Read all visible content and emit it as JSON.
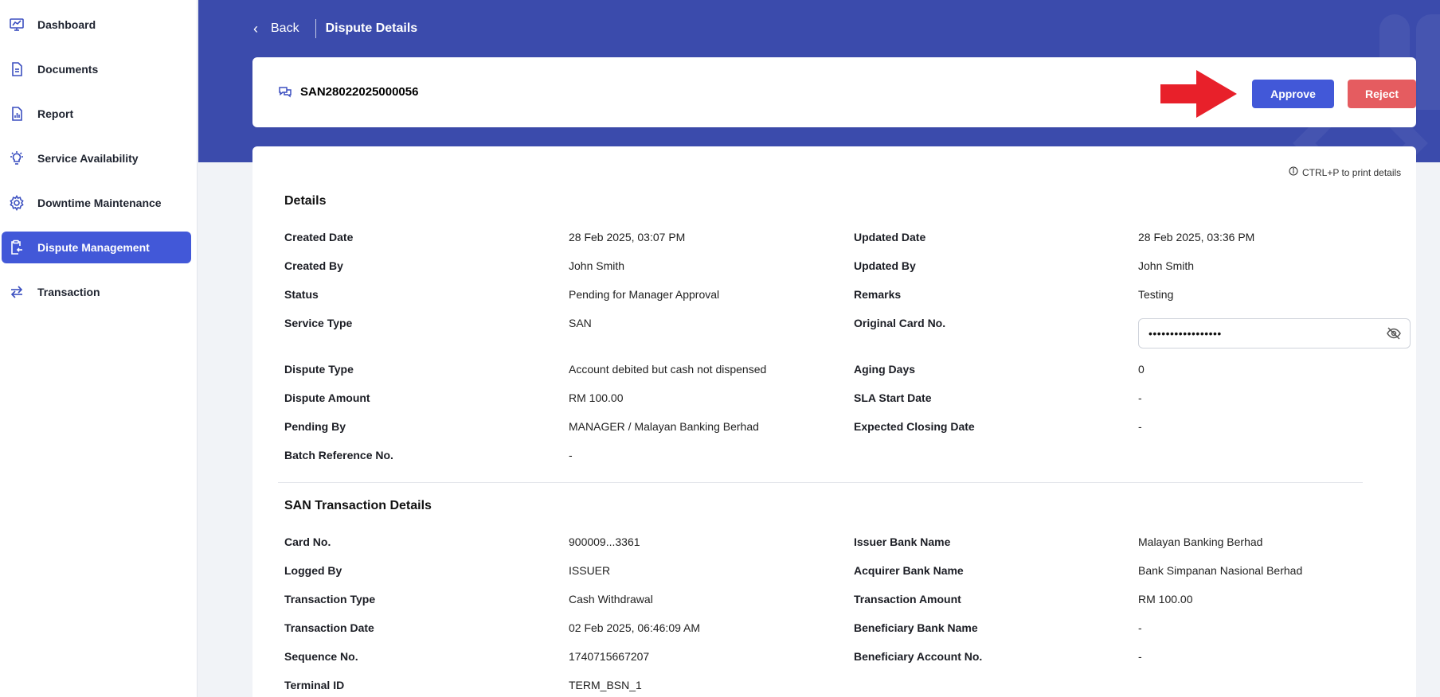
{
  "sidebar": {
    "items": [
      {
        "label": "Dashboard",
        "icon": "chart-line-icon"
      },
      {
        "label": "Documents",
        "icon": "document-icon"
      },
      {
        "label": "Report",
        "icon": "report-icon"
      },
      {
        "label": "Service Availability",
        "icon": "lightbulb-icon"
      },
      {
        "label": "Downtime Maintenance",
        "icon": "gear-icon"
      },
      {
        "label": "Dispute Management",
        "icon": "clipboard-icon",
        "active": true
      },
      {
        "label": "Transaction",
        "icon": "swap-icon"
      }
    ]
  },
  "header": {
    "back_label": "Back",
    "page_title": "Dispute Details"
  },
  "dispute": {
    "reference_no": "SAN28022025000056",
    "approve_label": "Approve",
    "reject_label": "Reject"
  },
  "print_hint": "CTRL+P to print details",
  "details": {
    "title": "Details",
    "created_date_label": "Created Date",
    "created_date": "28 Feb 2025, 03:07 PM",
    "updated_date_label": "Updated Date",
    "updated_date": "28 Feb 2025, 03:36 PM",
    "created_by_label": "Created By",
    "created_by": "John Smith",
    "updated_by_label": "Updated By",
    "updated_by": "John Smith",
    "status_label": "Status",
    "status": "Pending for Manager Approval",
    "remarks_label": "Remarks",
    "remarks": "Testing",
    "service_type_label": "Service Type",
    "service_type": "SAN",
    "original_card_label": "Original Card No.",
    "original_card_masked": "•••••••••••••••••",
    "dispute_type_label": "Dispute Type",
    "dispute_type": "Account debited but cash not dispensed",
    "aging_days_label": "Aging Days",
    "aging_days": "0",
    "dispute_amount_label": "Dispute Amount",
    "dispute_amount": "RM 100.00",
    "sla_start_label": "SLA Start Date",
    "sla_start": "-",
    "pending_by_label": "Pending By",
    "pending_by": "MANAGER / Malayan Banking Berhad",
    "expected_closing_label": "Expected Closing Date",
    "expected_closing": "-",
    "batch_ref_label": "Batch Reference No.",
    "batch_ref": "-"
  },
  "transaction": {
    "title": "SAN Transaction Details",
    "card_no_label": "Card No.",
    "card_no": "900009...3361",
    "issuer_bank_label": "Issuer Bank Name",
    "issuer_bank": "Malayan Banking Berhad",
    "logged_by_label": "Logged By",
    "logged_by": "ISSUER",
    "acquirer_bank_label": "Acquirer Bank Name",
    "acquirer_bank": "Bank Simpanan Nasional Berhad",
    "txn_type_label": "Transaction Type",
    "txn_type": "Cash Withdrawal",
    "txn_amount_label": "Transaction Amount",
    "txn_amount": "RM 100.00",
    "txn_date_label": "Transaction Date",
    "txn_date": "02 Feb 2025, 06:46:09 AM",
    "beneficiary_bank_label": "Beneficiary Bank Name",
    "beneficiary_bank": "-",
    "sequence_no_label": "Sequence No.",
    "sequence_no": "1740715667207",
    "beneficiary_account_label": "Beneficiary Account No.",
    "beneficiary_account": "-",
    "terminal_id_label": "Terminal ID",
    "terminal_id": "TERM_BSN_1"
  },
  "colors": {
    "primary": "#4258d8",
    "banner": "#3b4bac",
    "reject": "#e55c60",
    "annotation_arrow": "#e8202a"
  }
}
